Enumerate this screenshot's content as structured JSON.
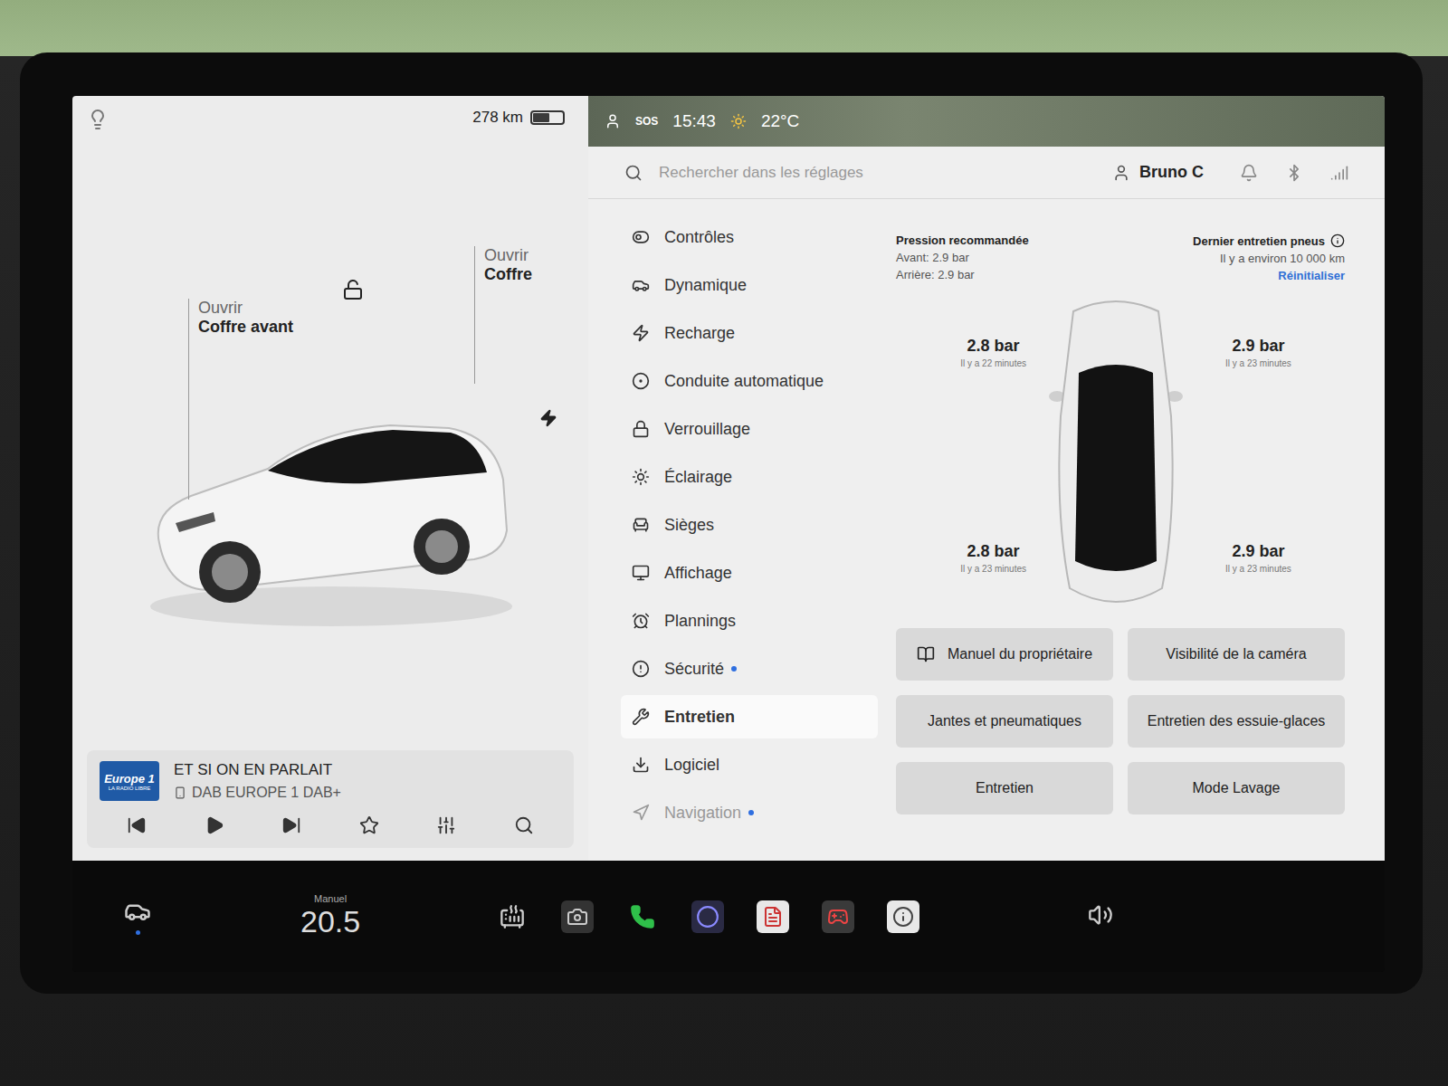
{
  "status_left": {
    "range": "278 km",
    "battery_level": 0.55,
    "charging": true
  },
  "status_right": {
    "sos": "SOS",
    "time": "15:43",
    "temperature": "22°C"
  },
  "car_view": {
    "front_trunk": {
      "action": "Ouvrir",
      "label": "Coffre avant"
    },
    "trunk": {
      "action": "Ouvrir",
      "label": "Coffre"
    },
    "locked": false
  },
  "media": {
    "logo": "Europe 1",
    "logo_tagline": "LA RADIO LIBRE",
    "title": "ET SI ON EN PARLAIT",
    "source": "DAB EUROPE 1 DAB+",
    "favorite": false
  },
  "search": {
    "placeholder": "Rechercher dans les réglages"
  },
  "user": {
    "name": "Bruno C"
  },
  "sidebar": {
    "items": [
      {
        "label": "Contrôles",
        "selected": false,
        "dot": false
      },
      {
        "label": "Dynamique",
        "selected": false,
        "dot": false
      },
      {
        "label": "Recharge",
        "selected": false,
        "dot": false
      },
      {
        "label": "Conduite automatique",
        "selected": false,
        "dot": false
      },
      {
        "label": "Verrouillage",
        "selected": false,
        "dot": false
      },
      {
        "label": "Éclairage",
        "selected": false,
        "dot": false
      },
      {
        "label": "Sièges",
        "selected": false,
        "dot": false
      },
      {
        "label": "Affichage",
        "selected": false,
        "dot": false
      },
      {
        "label": "Plannings",
        "selected": false,
        "dot": false
      },
      {
        "label": "Sécurité",
        "selected": false,
        "dot": true
      },
      {
        "label": "Entretien",
        "selected": true,
        "dot": false
      },
      {
        "label": "Logiciel",
        "selected": false,
        "dot": false
      },
      {
        "label": "Navigation",
        "selected": false,
        "dot": true
      }
    ]
  },
  "tires": {
    "recommended_title": "Pression recommandée",
    "recommended_front": "Avant: 2.9 bar",
    "recommended_rear": "Arrière: 2.9 bar",
    "last_service_title": "Dernier entretien pneus",
    "last_service_value": "Il y a environ 10 000 km",
    "reset": "Réinitialiser",
    "front_left": {
      "value": "2.8 bar",
      "time": "Il y a 22 minutes"
    },
    "front_right": {
      "value": "2.9 bar",
      "time": "Il y a 23 minutes"
    },
    "rear_left": {
      "value": "2.8 bar",
      "time": "Il y a 23 minutes"
    },
    "rear_right": {
      "value": "2.9 bar",
      "time": "Il y a 23 minutes"
    }
  },
  "buttons": [
    {
      "label": "Manuel du propriétaire",
      "icon": true
    },
    {
      "label": "Visibilité de la caméra",
      "icon": false
    },
    {
      "label": "Jantes et pneumatiques",
      "icon": false
    },
    {
      "label": "Entretien des essuie-glaces",
      "icon": false
    },
    {
      "label": "Entretien",
      "icon": false
    },
    {
      "label": "Mode Lavage",
      "icon": false
    }
  ],
  "taskbar": {
    "climate_mode": "Manuel",
    "temperature": "20.5"
  }
}
